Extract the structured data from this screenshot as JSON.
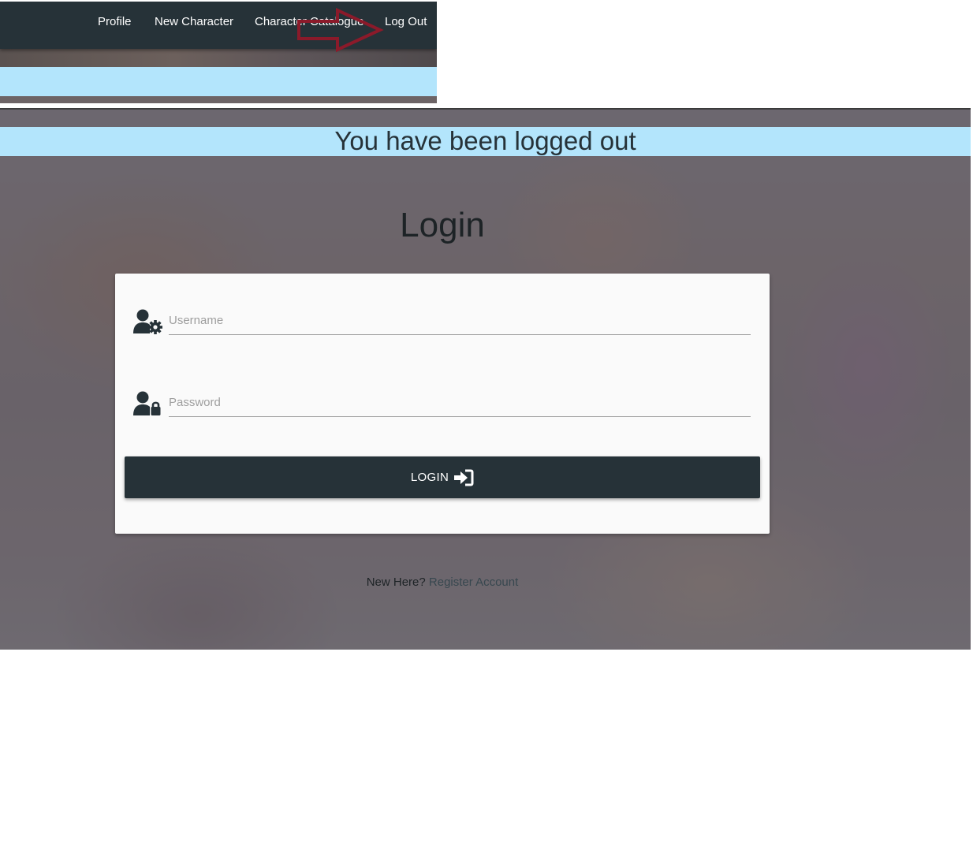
{
  "nav": {
    "items": [
      {
        "label": "Profile"
      },
      {
        "label": "New Character"
      },
      {
        "label": "Character Catalogue"
      },
      {
        "label": "Log Out"
      }
    ]
  },
  "alert": {
    "text": "You have been logged out",
    "color": "#b3e5fc"
  },
  "login": {
    "title": "Login",
    "username_placeholder": "Username",
    "password_placeholder": "Password",
    "button_label": "LOGIN",
    "button_color": "#263238"
  },
  "register": {
    "prompt": "New Here?",
    "link_label": "Register Account"
  },
  "icons": {
    "username": "user-gear-icon",
    "password": "user-lock-icon",
    "login": "sign-in-icon",
    "annotation": "red-arrow-icon"
  },
  "annotation_color": "#8b1a2a"
}
